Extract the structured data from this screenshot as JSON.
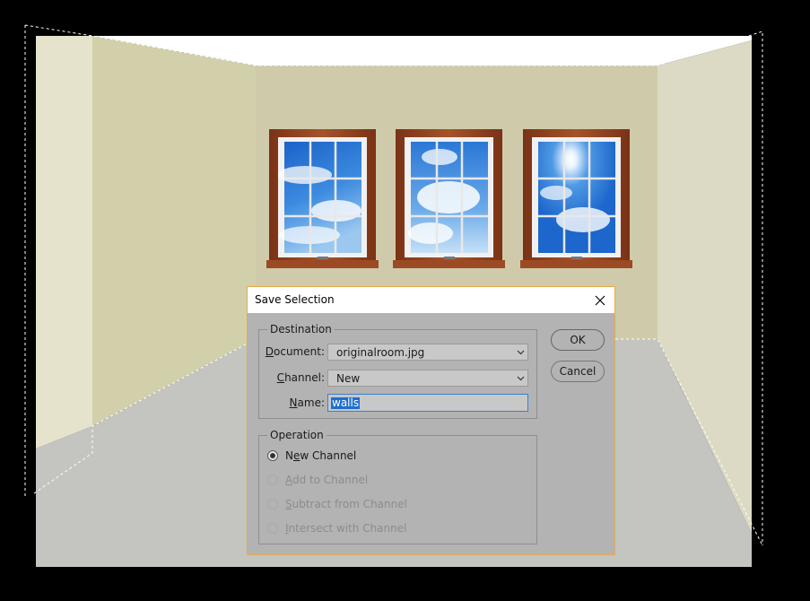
{
  "dialog": {
    "title": "Save Selection",
    "destination": {
      "legend": "Destination",
      "document_label": "Document:",
      "document_value": "originalroom.jpg",
      "channel_label": "Channel:",
      "channel_value": "New",
      "name_label": "Name:",
      "name_value": "walls"
    },
    "operation": {
      "legend": "Operation",
      "options": [
        {
          "label": "New Channel",
          "selected": true,
          "enabled": true
        },
        {
          "label": "Add to Channel",
          "selected": false,
          "enabled": false
        },
        {
          "label": "Subtract from Channel",
          "selected": false,
          "enabled": false
        },
        {
          "label": "Intersect with Channel",
          "selected": false,
          "enabled": false
        }
      ]
    },
    "ok_label": "OK",
    "cancel_label": "Cancel"
  },
  "colors": {
    "background": "#000000",
    "wall_back": "#cfcbaa",
    "wall_left": "#d2d0ab",
    "wall_right": "#dcdac4",
    "floor": "#c4c4c0",
    "window_frame": "#8b3f1e",
    "dialog_bg": "#b3b3b3",
    "dialog_border": "#e8a94a",
    "focus_blue": "#1f6fcf"
  }
}
